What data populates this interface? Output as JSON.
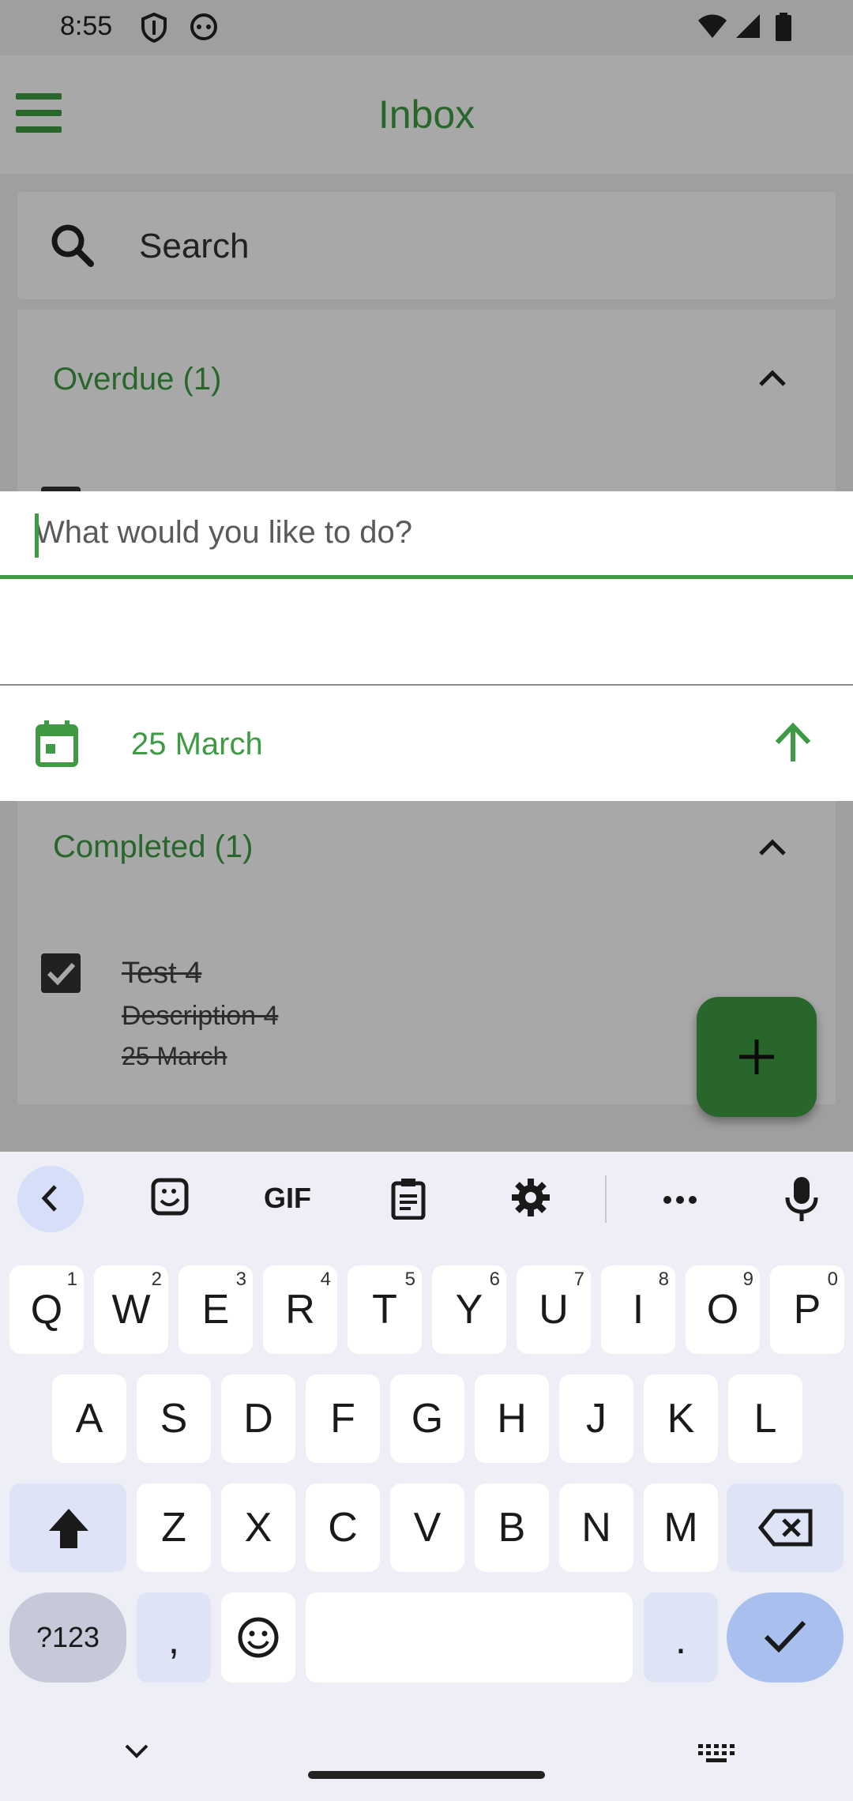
{
  "status_bar": {
    "time": "8:55"
  },
  "app_bar": {
    "title": "Inbox"
  },
  "search": {
    "placeholder": "Search"
  },
  "sections": {
    "overdue": {
      "title": "Overdue (1)"
    },
    "completed": {
      "title": "Completed (1)"
    }
  },
  "completed_task": {
    "title": "Test  4",
    "description": "Description 4",
    "date": "25 March",
    "checked": true
  },
  "new_task": {
    "placeholder": "What would you like to do?",
    "date": "25 March"
  },
  "keyboard": {
    "toolbar": [
      "back",
      "sticker",
      "GIF",
      "clipboard",
      "settings",
      "more",
      "mic"
    ],
    "row1": [
      {
        "k": "Q",
        "n": "1"
      },
      {
        "k": "W",
        "n": "2"
      },
      {
        "k": "E",
        "n": "3"
      },
      {
        "k": "R",
        "n": "4"
      },
      {
        "k": "T",
        "n": "5"
      },
      {
        "k": "Y",
        "n": "6"
      },
      {
        "k": "U",
        "n": "7"
      },
      {
        "k": "I",
        "n": "8"
      },
      {
        "k": "O",
        "n": "9"
      },
      {
        "k": "P",
        "n": "0"
      }
    ],
    "row2": [
      "A",
      "S",
      "D",
      "F",
      "G",
      "H",
      "J",
      "K",
      "L"
    ],
    "row3": [
      "Z",
      "X",
      "C",
      "V",
      "B",
      "N",
      "M"
    ],
    "symbols_label": "?123",
    "comma": ",",
    "period": ".",
    "gif_label": "GIF"
  },
  "colors": {
    "accent": "#3e9b43",
    "keyboard_bg": "#eeeef6",
    "enter": "#a9c0ef"
  }
}
